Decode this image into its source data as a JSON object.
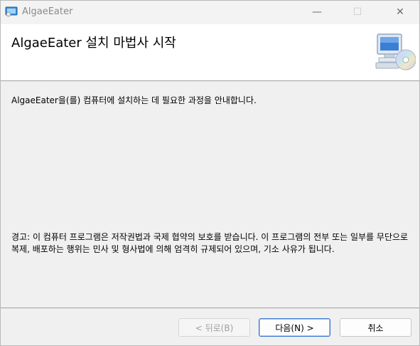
{
  "window": {
    "title": "AlgaeEater",
    "minimize_glyph": "—",
    "maximize_glyph": "☐",
    "close_glyph": "✕"
  },
  "banner": {
    "title": "AlgaeEater 설치 마법사 시작",
    "icon": "computer-cd-icon"
  },
  "body": {
    "intro": "AlgaeEater을(를) 컴퓨터에 설치하는 데 필요한 과정을 안내합니다.",
    "warning": "경고: 이 컴퓨터 프로그램은 저작권법과 국제 협약의 보호를 받습니다. 이 프로그램의 전부 또는 일부를 무단으로 복제, 배포하는 행위는 민사 및 형사법에 의해 엄격히 규제되어 있으며, 기소 사유가 됩니다."
  },
  "buttons": {
    "back": "< 뒤로(B)",
    "next": "다음(N) >",
    "cancel": "취소"
  }
}
